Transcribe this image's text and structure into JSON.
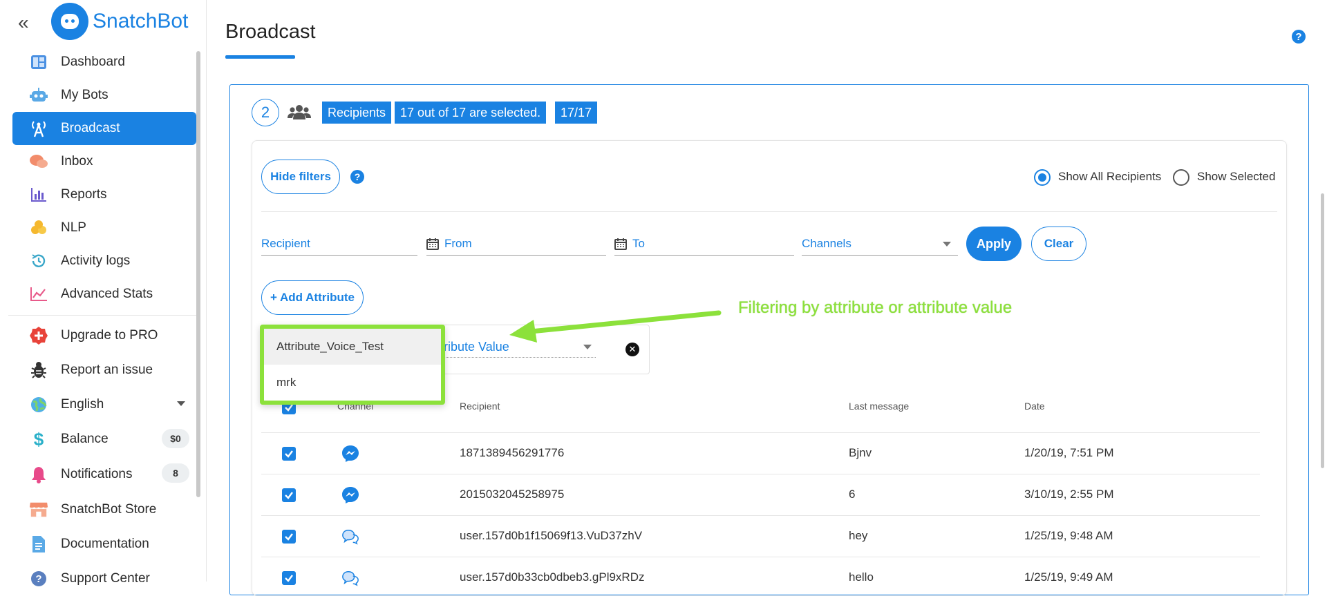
{
  "app": {
    "name": "SnatchBot"
  },
  "sidebar": {
    "items": [
      {
        "label": "Dashboard"
      },
      {
        "label": "My Bots"
      },
      {
        "label": "Broadcast",
        "active": true
      },
      {
        "label": "Inbox"
      },
      {
        "label": "Reports"
      },
      {
        "label": "NLP"
      },
      {
        "label": "Activity logs"
      },
      {
        "label": "Advanced Stats"
      }
    ],
    "secondary": [
      {
        "label": "Upgrade to PRO"
      },
      {
        "label": "Report an issue"
      },
      {
        "label": "English"
      },
      {
        "label": "Balance",
        "badge": "$0"
      },
      {
        "label": "Notifications",
        "badge": "8"
      },
      {
        "label": "SnatchBot Store"
      },
      {
        "label": "Documentation"
      },
      {
        "label": "Support Center"
      }
    ]
  },
  "page": {
    "title": "Broadcast"
  },
  "step": {
    "number": "2",
    "tags": [
      "Recipients",
      "17 out of 17 are selected.",
      "17/17"
    ]
  },
  "filters": {
    "hide_label": "Hide filters",
    "show_all": "Show All Recipients",
    "show_selected": "Show Selected",
    "recipient_placeholder": "Recipient",
    "from_placeholder": "From",
    "to_placeholder": "To",
    "channels_placeholder": "Channels",
    "apply": "Apply",
    "clear": "Clear",
    "add_attribute": "+ Add Attribute",
    "attribute_value_placeholder": "Attribute Value",
    "attribute_options": [
      "Attribute_Voice_Test",
      "mrk"
    ]
  },
  "annotation": {
    "text": "Filtering by attribute or attribute value",
    "color": "#8ce13b"
  },
  "table": {
    "headers": [
      "Channel",
      "Recipient",
      "Last message",
      "Date"
    ],
    "rows": [
      {
        "channel": "messenger",
        "recipient": "1871389456291776",
        "last_message": "Bjnv",
        "date": "1/20/19, 7:51 PM"
      },
      {
        "channel": "messenger",
        "recipient": "2015032045258975",
        "last_message": "6",
        "date": "3/10/19, 2:55 PM"
      },
      {
        "channel": "webchat",
        "recipient": "user.157d0b1f15069f13.VuD37zhV",
        "last_message": "hey",
        "date": "1/25/19, 9:48 AM"
      },
      {
        "channel": "webchat",
        "recipient": "user.157d0b33cb0dbeb3.gPl9xRDz",
        "last_message": "hello",
        "date": "1/25/19, 9:49 AM"
      }
    ]
  },
  "colors": {
    "accent": "#1a82e2",
    "annotation": "#8ce13b"
  }
}
